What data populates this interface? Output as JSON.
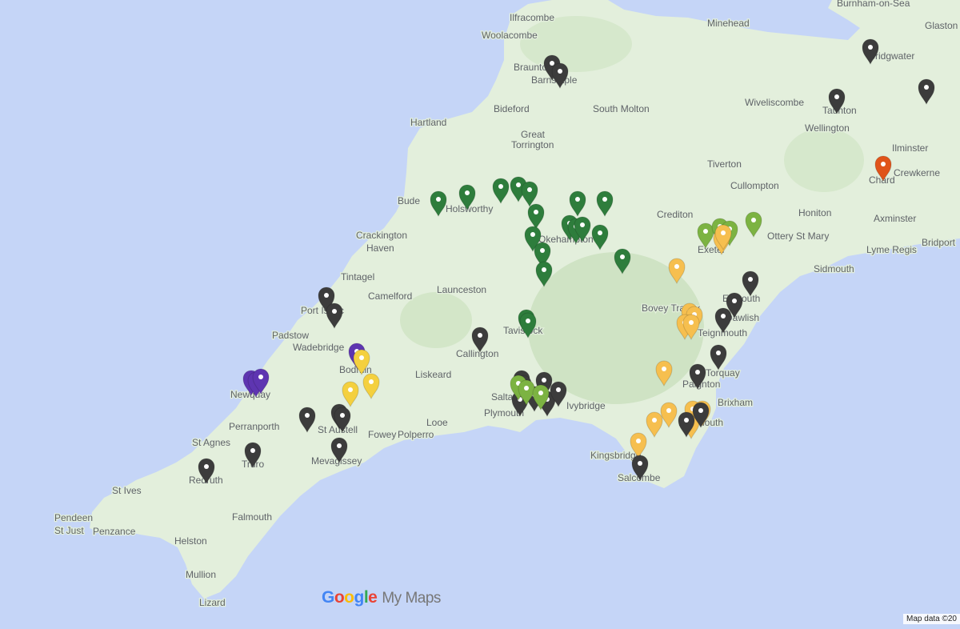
{
  "map": {
    "logo": {
      "letters": [
        "G",
        "o",
        "o",
        "g",
        "l",
        "e"
      ],
      "suffix": "My Maps"
    },
    "attribution": "Map data ©20",
    "colors": {
      "sea": "#c5d5f7",
      "land": "#e3efdc",
      "moor": "#cfe3c4",
      "label": "#5f6368"
    },
    "place_labels": [
      {
        "name": "Ilfracombe"
      },
      {
        "name": "Woolacombe"
      },
      {
        "name": "Braunton"
      },
      {
        "name": "Barnstaple"
      },
      {
        "name": "Minehead"
      },
      {
        "name": "Burnham-on-Sea"
      },
      {
        "name": "Glaston"
      },
      {
        "name": "Bridgwater"
      },
      {
        "name": "Bideford"
      },
      {
        "name": "South Molton"
      },
      {
        "name": "Wiveliscombe"
      },
      {
        "name": "Taunton"
      },
      {
        "name": "Hartland"
      },
      {
        "name": "Great"
      },
      {
        "name": "Torrington"
      },
      {
        "name": "Wellington"
      },
      {
        "name": "Ilminster"
      },
      {
        "name": "Crewkerne"
      },
      {
        "name": "Chard"
      },
      {
        "name": "Tiverton"
      },
      {
        "name": "Cullompton"
      },
      {
        "name": "Bude"
      },
      {
        "name": "Holsworthy"
      },
      {
        "name": "Crediton"
      },
      {
        "name": "Honiton"
      },
      {
        "name": "Axminster"
      },
      {
        "name": "Ottery St Mary"
      },
      {
        "name": "Crackington"
      },
      {
        "name": "Haven"
      },
      {
        "name": "Okehampton"
      },
      {
        "name": "Exeter"
      },
      {
        "name": "Bridport"
      },
      {
        "name": "Lyme Regis"
      },
      {
        "name": "Sidmouth"
      },
      {
        "name": "Tintagel"
      },
      {
        "name": "Camelford"
      },
      {
        "name": "Launceston"
      },
      {
        "name": "Exmouth"
      },
      {
        "name": "Port Isaac"
      },
      {
        "name": "Bovey Tracey"
      },
      {
        "name": "Dawlish"
      },
      {
        "name": "Padstow"
      },
      {
        "name": "Tavistock"
      },
      {
        "name": "Teignmouth"
      },
      {
        "name": "Wadebridge"
      },
      {
        "name": "Callington"
      },
      {
        "name": "Bodmin"
      },
      {
        "name": "Liskeard"
      },
      {
        "name": "Torquay"
      },
      {
        "name": "Newquay"
      },
      {
        "name": "Saltash"
      },
      {
        "name": "Paignton"
      },
      {
        "name": "Brixham"
      },
      {
        "name": "Perranporth"
      },
      {
        "name": "Plymouth"
      },
      {
        "name": "Ivybridge"
      },
      {
        "name": "Looe"
      },
      {
        "name": "Dartmouth"
      },
      {
        "name": "St Austell"
      },
      {
        "name": "Fowey"
      },
      {
        "name": "Polperro"
      },
      {
        "name": "St Agnes"
      },
      {
        "name": "Kingsbridge"
      },
      {
        "name": "Mevagissey"
      },
      {
        "name": "Truro"
      },
      {
        "name": "Salcombe"
      },
      {
        "name": "Redruth"
      },
      {
        "name": "St Ives"
      },
      {
        "name": "Pendeen"
      },
      {
        "name": "St Just"
      },
      {
        "name": "Penzance"
      },
      {
        "name": "Falmouth"
      },
      {
        "name": "Helston"
      },
      {
        "name": "Mullion"
      },
      {
        "name": "Lizard"
      }
    ],
    "pin_colors": {
      "dark": "#3c3c3c",
      "green": "#2e7d3c",
      "lightgreen": "#7cb342",
      "yellow": "#f4d03f",
      "orange": "#f6bf4f",
      "purple": "#5e35b1",
      "red": "#e0541a"
    },
    "pins": [
      {
        "color": "dark"
      },
      {
        "color": "dark"
      },
      {
        "color": "dark"
      },
      {
        "color": "dark"
      },
      {
        "color": "dark"
      },
      {
        "color": "red"
      },
      {
        "color": "green"
      },
      {
        "color": "green"
      },
      {
        "color": "green"
      },
      {
        "color": "green"
      },
      {
        "color": "green"
      },
      {
        "color": "green"
      },
      {
        "color": "green"
      },
      {
        "color": "green"
      },
      {
        "color": "green"
      },
      {
        "color": "green"
      },
      {
        "color": "green"
      },
      {
        "color": "green"
      },
      {
        "color": "green"
      },
      {
        "color": "green"
      },
      {
        "color": "green"
      },
      {
        "color": "green"
      },
      {
        "color": "green"
      },
      {
        "color": "green"
      },
      {
        "color": "lightgreen"
      },
      {
        "color": "lightgreen"
      },
      {
        "color": "lightgreen"
      },
      {
        "color": "lightgreen"
      },
      {
        "color": "orange"
      },
      {
        "color": "orange"
      },
      {
        "color": "orange"
      },
      {
        "color": "dark"
      },
      {
        "color": "dark"
      },
      {
        "color": "dark"
      },
      {
        "color": "orange"
      },
      {
        "color": "orange"
      },
      {
        "color": "orange"
      },
      {
        "color": "orange"
      },
      {
        "color": "dark"
      },
      {
        "color": "dark"
      },
      {
        "color": "dark"
      },
      {
        "color": "dark"
      },
      {
        "color": "orange"
      },
      {
        "color": "orange"
      },
      {
        "color": "orange"
      },
      {
        "color": "orange"
      },
      {
        "color": "orange"
      },
      {
        "color": "orange"
      },
      {
        "color": "orange"
      },
      {
        "color": "dark"
      },
      {
        "color": "dark"
      },
      {
        "color": "dark"
      },
      {
        "color": "purple"
      },
      {
        "color": "purple"
      },
      {
        "color": "purple"
      },
      {
        "color": "purple"
      },
      {
        "color": "yellow"
      },
      {
        "color": "yellow"
      },
      {
        "color": "yellow"
      },
      {
        "color": "dark"
      },
      {
        "color": "dark"
      },
      {
        "color": "dark"
      },
      {
        "color": "dark"
      },
      {
        "color": "dark"
      },
      {
        "color": "dark"
      },
      {
        "color": "dark"
      },
      {
        "color": "dark"
      },
      {
        "color": "dark"
      },
      {
        "color": "dark"
      },
      {
        "color": "dark"
      },
      {
        "color": "dark"
      },
      {
        "color": "dark"
      },
      {
        "color": "dark"
      },
      {
        "color": "lightgreen"
      },
      {
        "color": "lightgreen"
      },
      {
        "color": "lightgreen"
      }
    ]
  }
}
